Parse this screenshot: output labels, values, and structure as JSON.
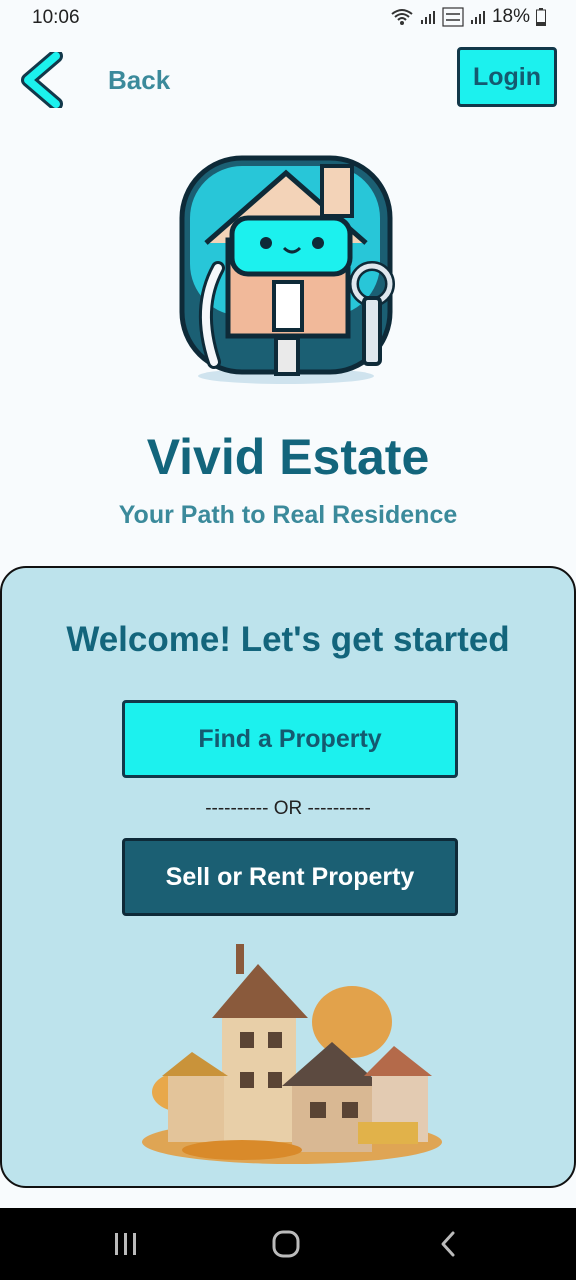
{
  "status_bar": {
    "time": "10:06",
    "battery": "18%"
  },
  "header": {
    "back_label": "Back",
    "login_label": "Login"
  },
  "brand": {
    "title": "Vivid Estate",
    "subtitle": "Your Path to Real Residence"
  },
  "card": {
    "welcome": "Welcome! Let's get started",
    "find_label": "Find a Property",
    "or_label": "---------- OR ----------",
    "sell_label": "Sell or Rent Property"
  },
  "colors": {
    "accent": "#1cf1ee",
    "primary": "#13657c",
    "card_bg": "#bde3ec",
    "dark_button": "#1b5f73"
  }
}
